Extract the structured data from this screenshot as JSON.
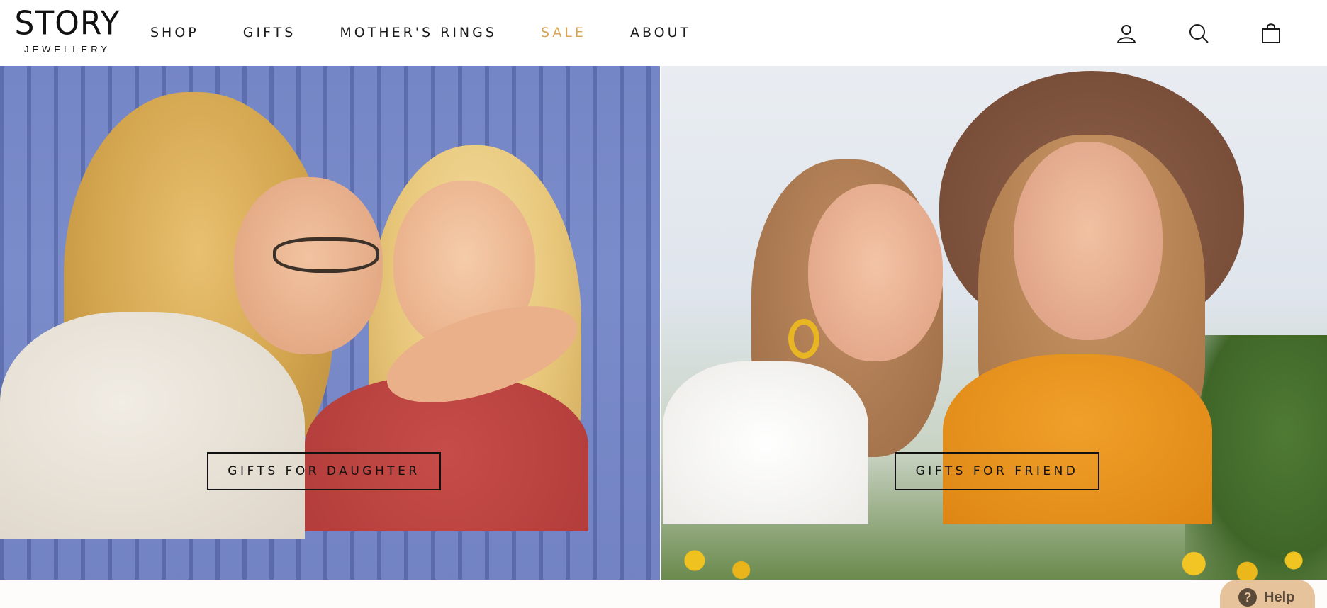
{
  "brand": {
    "logo_main": "STORY",
    "logo_sub": "JEWELLERY"
  },
  "nav": {
    "items": [
      {
        "label": "SHOP"
      },
      {
        "label": "GIFTS"
      },
      {
        "label": "MOTHER'S RINGS"
      },
      {
        "label": "SALE",
        "color": "#d8a552"
      },
      {
        "label": "ABOUT"
      }
    ]
  },
  "header_icons": [
    "user-icon",
    "search-icon",
    "shopping-bag-icon"
  ],
  "hero": {
    "left": {
      "cta_label": "GIFTS FOR DAUGHTER"
    },
    "right": {
      "cta_label": "GIFTS FOR FRIEND"
    }
  },
  "help": {
    "label": "Help",
    "icon_glyph": "?"
  },
  "colors": {
    "sale_accent": "#d8a552",
    "help_bg": "#e6c39a",
    "help_text": "#5a4a3a"
  }
}
